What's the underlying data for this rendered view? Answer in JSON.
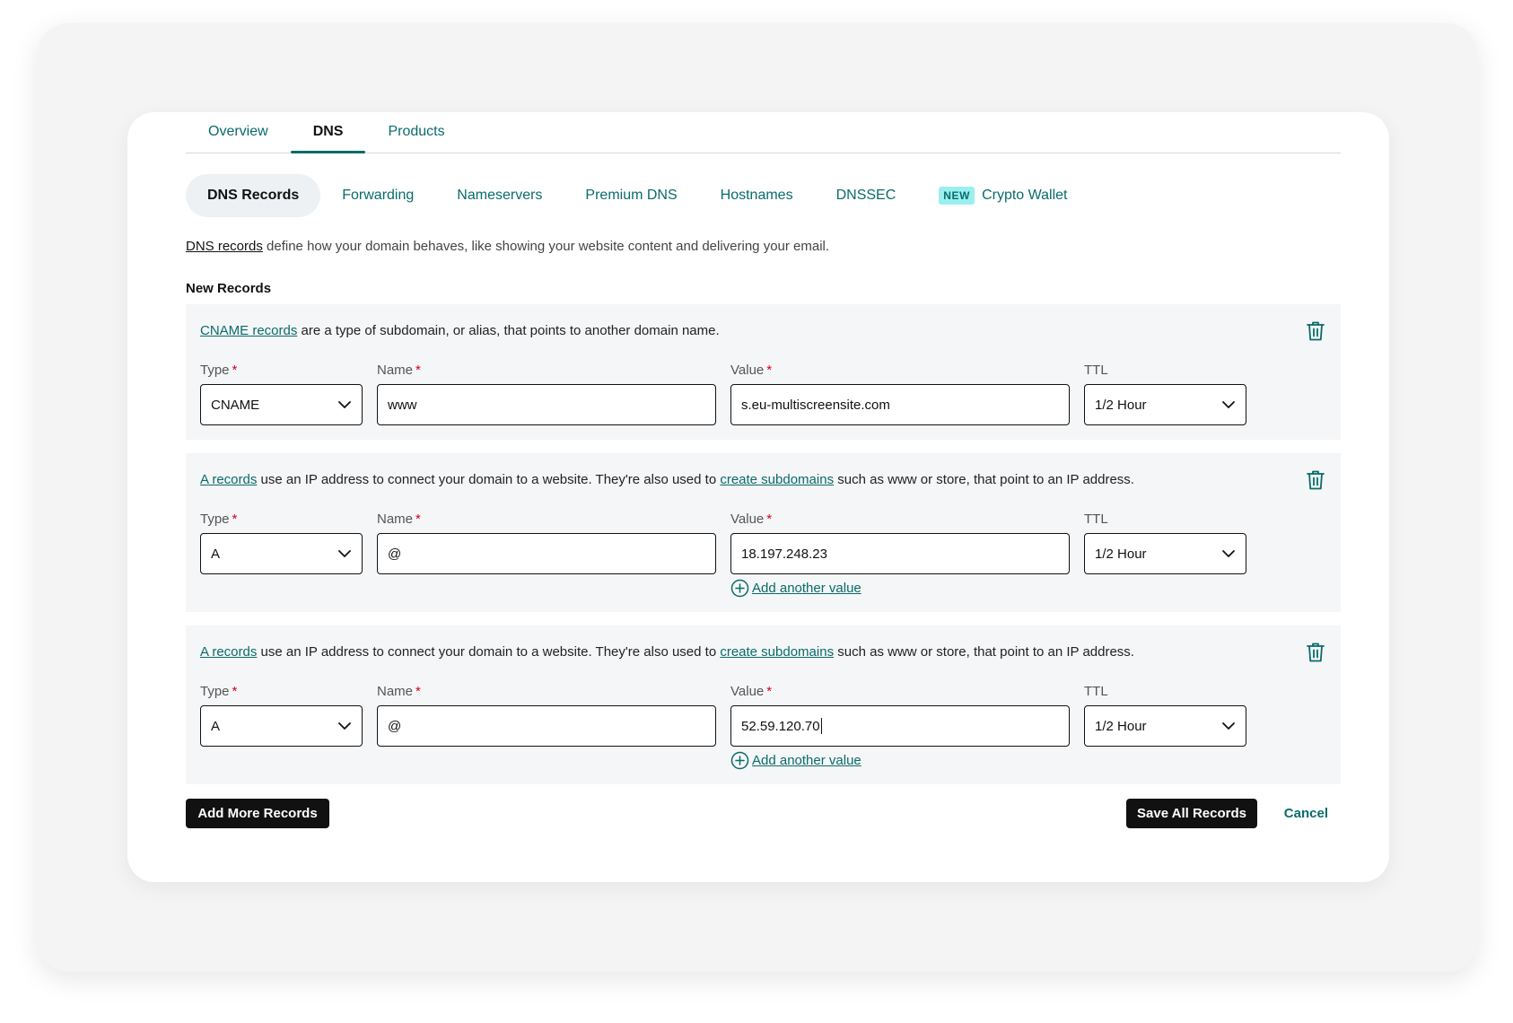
{
  "top_tabs": [
    "Overview",
    "DNS",
    "Products"
  ],
  "active_top_tab": "DNS",
  "sub_tabs": [
    {
      "label": "DNS Records",
      "active": true,
      "badge": ""
    },
    {
      "label": "Forwarding",
      "active": false,
      "badge": ""
    },
    {
      "label": "Nameservers",
      "active": false,
      "badge": ""
    },
    {
      "label": "Premium DNS",
      "active": false,
      "badge": ""
    },
    {
      "label": "Hostnames",
      "active": false,
      "badge": ""
    },
    {
      "label": "DNSSEC",
      "active": false,
      "badge": ""
    },
    {
      "label": "Crypto Wallet",
      "active": false,
      "badge": "NEW"
    }
  ],
  "intro": {
    "link": "DNS records",
    "text": " define how your domain behaves, like showing your website content and delivering your email."
  },
  "section_title": "New Records",
  "field_labels": {
    "type": "Type",
    "name": "Name",
    "value": "Value",
    "ttl": "TTL",
    "required_mark": "*"
  },
  "records": [
    {
      "desc_link1": "CNAME records",
      "desc_text1": " are a type of subdomain, or alias, that points to another domain name.",
      "desc_link2": "",
      "desc_text2": "",
      "type": "CNAME",
      "name": "www",
      "value": "s.eu-multiscreensite.com",
      "ttl": "1/2 Hour",
      "add_value": ""
    },
    {
      "desc_link1": "A records",
      "desc_text1": " use an IP address to connect your domain to a website. They're also used to ",
      "desc_link2": "create subdomains",
      "desc_text2": " such as www or store, that point to an IP address.",
      "type": "A",
      "name": "@",
      "value": "18.197.248.23",
      "ttl": "1/2 Hour",
      "add_value": "Add another value"
    },
    {
      "desc_link1": "A records",
      "desc_text1": " use an IP address to connect your domain to a website. They're also used to ",
      "desc_link2": "create subdomains",
      "desc_text2": " such as www or store, that point to an IP address.",
      "type": "A",
      "name": "@",
      "value": "52.59.120.70",
      "ttl": "1/2 Hour",
      "add_value": "Add another value"
    }
  ],
  "buttons": {
    "add_more": "Add More Records",
    "save_all": "Save All Records",
    "cancel": "Cancel"
  },
  "colors": {
    "accent": "#0a6b6b",
    "badge_bg": "#9bf0ef",
    "required": "#d0021b",
    "dark_button": "#111111",
    "record_bg": "#f5f6f7"
  },
  "icons": {
    "delete": "trash-icon",
    "dropdown": "chevron-down-icon",
    "add": "plus-circle-icon"
  }
}
